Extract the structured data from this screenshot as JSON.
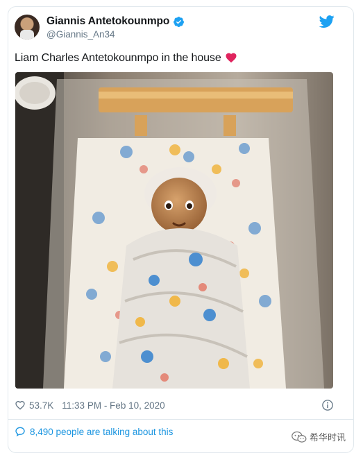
{
  "tweet": {
    "author_name": "Giannis Antetokounmpo",
    "author_handle": "@Giannis_An34",
    "text": "Liam Charles Antetokounmpo in the house",
    "likes": "53.7K",
    "timestamp": "11:33 PM - Feb 10, 2020",
    "talking": "8,490 people are talking about this"
  },
  "icons": {
    "verified": "verified-badge-icon",
    "brand": "twitter-bird-icon",
    "emoji": "red-heart-icon",
    "like": "heart-outline-icon",
    "info": "info-icon",
    "reply": "speech-bubble-icon",
    "watermark": "wechat-icon"
  },
  "watermark": {
    "text": "希华时讯"
  },
  "colors": {
    "twitter_blue": "#1da1f2",
    "link_blue": "#1b95e0",
    "muted": "#657786",
    "heart_red": "#e0245e"
  }
}
